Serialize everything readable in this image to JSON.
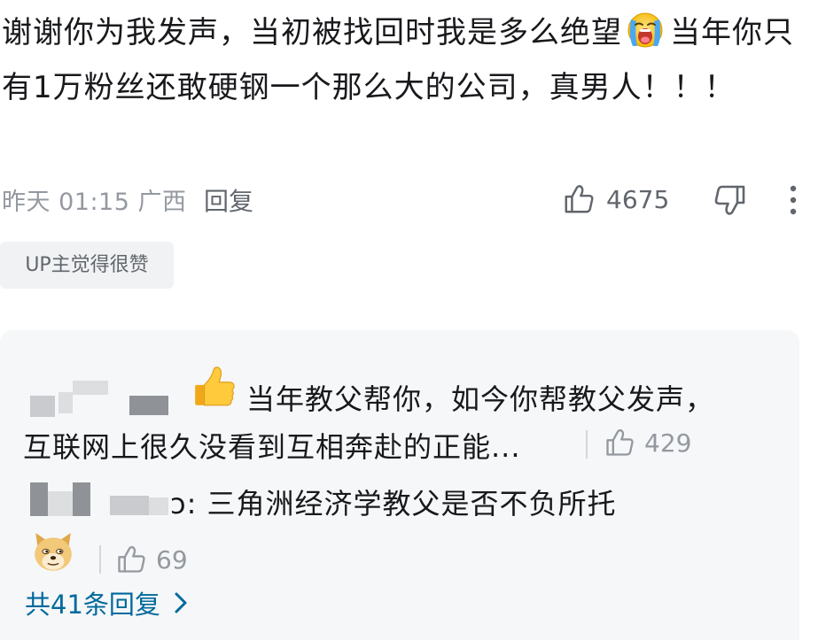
{
  "comment": {
    "text_part1": "谢谢你为我发声，当初被找回时我是多么绝望",
    "emoji_name": "crying-face-icon",
    "text_part2": "当年你只有1万粉丝还敢硬钢一个那么大的公司，真男人！！！",
    "time": "昨天 01:15 广西",
    "reply_label": "回复",
    "like_count": "4675",
    "badge": "UP主觉得很赞"
  },
  "replies": [
    {
      "text_line1": "当年教父帮你，如今你帮教父发声，",
      "text_line2": "互联网上很久没看到互相奔赴的正能...",
      "emoji_name": "thumbs-up-emoji",
      "like_count": "429"
    },
    {
      "text": "ɔ: 三角洲经济学教父是否不负所托",
      "emoji_name": "doge-emoji",
      "like_count": "69"
    }
  ],
  "more_replies_label": "共41条回复",
  "colors": {
    "text": "#18191c",
    "muted": "#9499a0",
    "link": "#00699d",
    "panel": "#f6f7f8"
  }
}
